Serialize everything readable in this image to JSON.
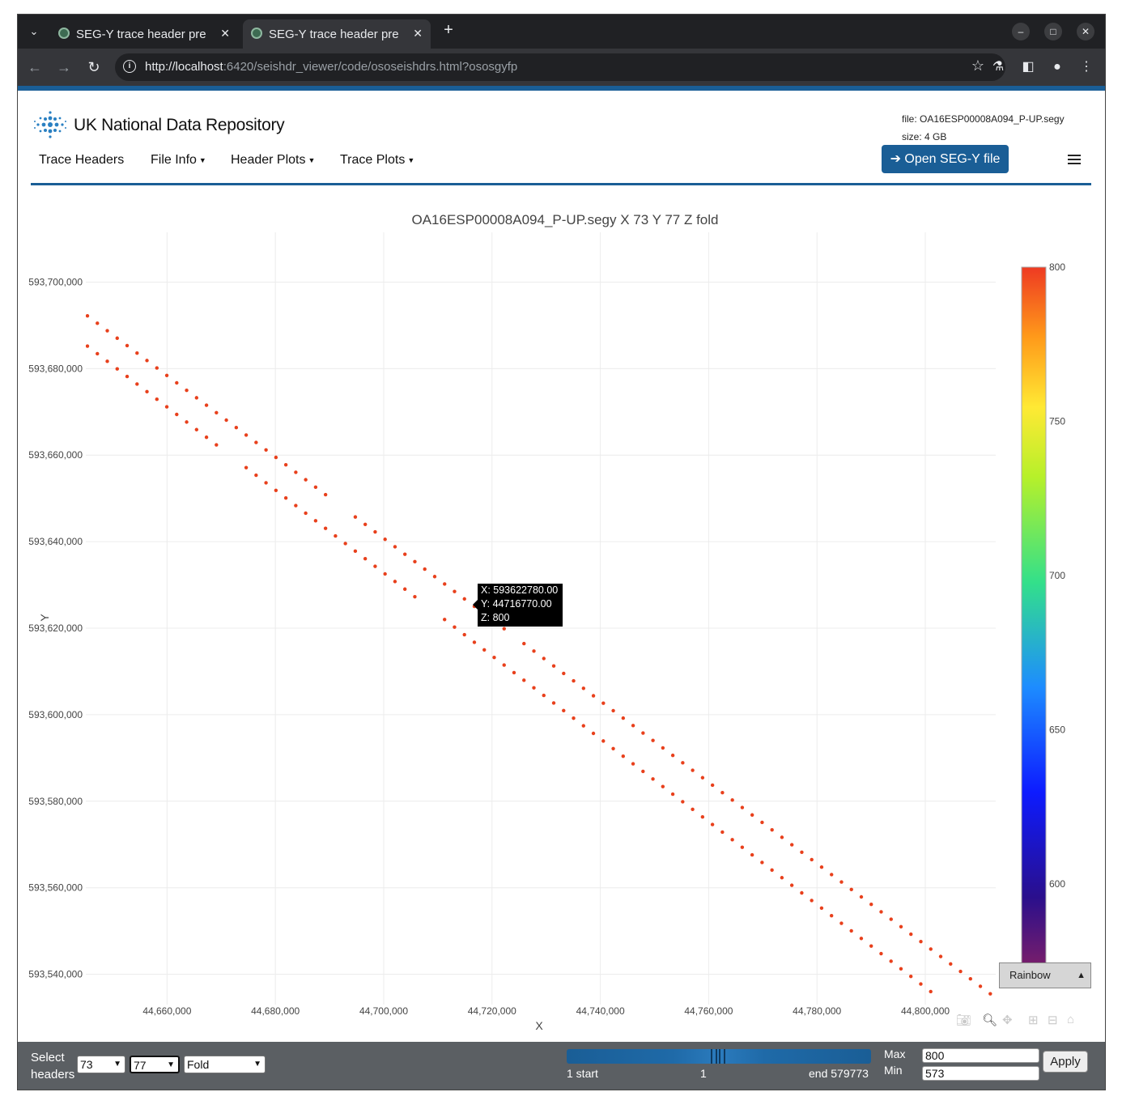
{
  "browser": {
    "tabs": [
      {
        "title": "SEG-Y trace header prev",
        "active": false
      },
      {
        "title": "SEG-Y trace header prev",
        "active": true
      }
    ],
    "url_host": "http://localhost",
    "url_rest": ":6420/seishdr_viewer/code/ososeishdrs.html?ososgyfp"
  },
  "header": {
    "brand": "UK National Data Repository",
    "file_line": "file: OA16ESP00008A094_P-UP.segy",
    "size_line": "size: 4 GB",
    "open_button": "➔ Open SEG-Y file",
    "menu": [
      {
        "label": "Trace Headers",
        "dropdown": false
      },
      {
        "label": "File Info",
        "dropdown": true
      },
      {
        "label": "Header Plots",
        "dropdown": true
      },
      {
        "label": "Trace Plots",
        "dropdown": true
      }
    ]
  },
  "chart_data": {
    "type": "scatter",
    "title": "OA16ESP00008A094_P-UP.segy X 73 Y 77 Z fold",
    "xlabel": "X",
    "ylabel": "Y",
    "xlim": [
      44645000,
      44813000
    ],
    "ylim": [
      593533000,
      593711500
    ],
    "x_ticks": [
      44660000,
      44680000,
      44700000,
      44720000,
      44740000,
      44760000,
      44780000,
      44800000
    ],
    "x_tick_labels": [
      "44,660,000",
      "44,680,000",
      "44,700,000",
      "44,720,000",
      "44,740,000",
      "44,760,000",
      "44,780,000",
      "44,800,000"
    ],
    "y_ticks": [
      593700000,
      593680000,
      593660000,
      593640000,
      593620000,
      593600000,
      593580000,
      593560000,
      593540000
    ],
    "y_tick_labels": [
      "593,700,000",
      "593,680,000",
      "593,660,000",
      "593,640,000",
      "593,620,000",
      "593,600,000",
      "593,580,000",
      "593,560,000",
      "593,540,000"
    ],
    "grid": true,
    "marker_color": "#e8401c",
    "series": [
      {
        "x_start": 44645300,
        "y_start": 593692200,
        "x_end": 44812000,
        "y_end": 593535500,
        "points": 92,
        "z": 800
      },
      {
        "x_start": 44645300,
        "y_start": 593685200,
        "x_end": 44801000,
        "y_end": 593536000,
        "points": 86,
        "z": 800
      }
    ],
    "gaps": [
      {
        "series": 0,
        "after_x": 44692000
      },
      {
        "series": 0,
        "after_x": 44724000
      },
      {
        "series": 1,
        "after_x": 44672000
      },
      {
        "series": 1,
        "after_x": 44709000
      }
    ],
    "colorbar": {
      "scale": "Rainbow",
      "min": 573,
      "max": 800,
      "ticks": [
        800,
        750,
        700,
        650,
        600
      ],
      "tick_labels": [
        "800",
        "750",
        "700",
        "650",
        "600"
      ]
    },
    "hover": {
      "x_line": "X: 593622780.00",
      "y_line": "Y: 44716770.00",
      "z_line": "Z: 800"
    }
  },
  "controls": {
    "select_label_1": "Select",
    "select_label_2": "headers",
    "x_header": "73",
    "y_header": "77",
    "z_header": "Fold",
    "slider_start_label": "1 start",
    "slider_mid_label": "1",
    "slider_end_label": "end 579773",
    "max_label": "Max",
    "min_label": "Min",
    "max_value": "800",
    "min_value": "573",
    "apply_button": "Apply",
    "colormap": "Rainbow"
  }
}
